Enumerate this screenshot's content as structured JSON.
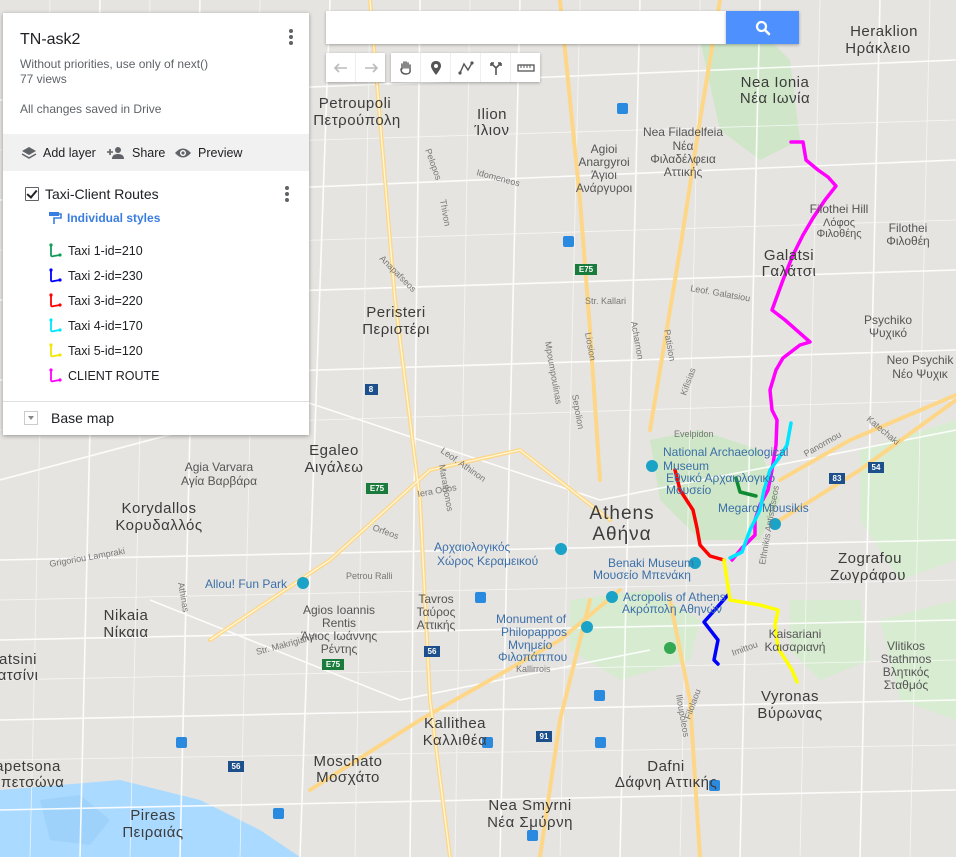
{
  "panel": {
    "title": "TN-ask2",
    "description": "Without priorities, use only of next()",
    "views": "77 views",
    "saved": "All changes saved in Drive",
    "actions": {
      "add_layer": "Add layer",
      "share": "Share",
      "preview": "Preview"
    },
    "layer": {
      "name": "Taxi-Client Routes",
      "styles": "Individual styles",
      "routes": [
        {
          "label": "Taxi 1-id=210",
          "color": "#0f9d58"
        },
        {
          "label": "Taxi 2-id=230",
          "color": "#0000ff"
        },
        {
          "label": "Taxi 3-id=220",
          "color": "#ff0000"
        },
        {
          "label": "Taxi 4-id=170",
          "color": "#00ffff"
        },
        {
          "label": "Taxi 5-id=120",
          "color": "#ffff00"
        },
        {
          "label": "CLIENT ROUTE",
          "color": "#ff00ff"
        }
      ]
    },
    "basemap": "Base map"
  },
  "search": {
    "placeholder": "",
    "value": ""
  },
  "toolbar_icons": [
    "undo-icon",
    "redo-icon",
    "hand-icon",
    "marker-icon",
    "draw-line-icon",
    "directions-icon",
    "ruler-icon"
  ],
  "map": {
    "places": [
      {
        "id": "heraklion",
        "l1": "Heraklion",
        "l2": "Ηράκλειο"
      },
      {
        "id": "neaionia",
        "l1": "Nea Ionia",
        "l2": "Νέα Ιωνία"
      },
      {
        "id": "petroupoli",
        "l1": "Petroupoli",
        "l2": "Πετρούπολη"
      },
      {
        "id": "ilion",
        "l1": "Ilion",
        "l2": "Ίλιον"
      },
      {
        "id": "agioianargyroi",
        "l1": "Agioi",
        "l2": "Anargyroi",
        "l3": "Άγιοι",
        "l4": "Ανάργυροι"
      },
      {
        "id": "neafiladelfeia",
        "l1": "Nea Filadelfeia",
        "l2": "Νέα",
        "l3": "Φιλαδέλφεια",
        "l4": "Αττικής"
      },
      {
        "id": "filothei",
        "l1": "Filothei Hill",
        "l2": "Λόφος",
        "l3": "Φιλοθέης"
      },
      {
        "id": "filothei2",
        "l1": "Filothei",
        "l2": "Φιλοθέη"
      },
      {
        "id": "galatsi",
        "l1": "Galatsi",
        "l2": "Γαλάτσι"
      },
      {
        "id": "peristeri",
        "l1": "Peristeri",
        "l2": "Περιστέρι"
      },
      {
        "id": "psychiko",
        "l1": "Psychiko",
        "l2": "Ψυχικό"
      },
      {
        "id": "neopsychiko",
        "l1": "Neo Psychik",
        "l2": "Νέο Ψυχικ"
      },
      {
        "id": "egaleo",
        "l1": "Egaleo",
        "l2": "Αιγάλεω"
      },
      {
        "id": "agiavarvara",
        "l1": "Agia Varvara",
        "l2": "Αγία Βαρβάρα"
      },
      {
        "id": "korydallos",
        "l1": "Korydallos",
        "l2": "Κορυδαλλός"
      },
      {
        "id": "athens",
        "l1": "Athens",
        "l2": "Αθήνα"
      },
      {
        "id": "zografou",
        "l1": "Zografou",
        "l2": "Ζωγράφου"
      },
      {
        "id": "nikaia",
        "l1": "Nikaia",
        "l2": "Νίκαια"
      },
      {
        "id": "atsini",
        "l1": "atsini",
        "l2": "ατσίνι"
      },
      {
        "id": "agiosioannis",
        "l1": "Agios Ioannis",
        "l2": "Rentis",
        "l3": "Άγιος Ιωάννης",
        "l4": "Ρέντης"
      },
      {
        "id": "tavros",
        "l1": "Tavros",
        "l2": "Ταύρος",
        "l3": "Αττικής"
      },
      {
        "id": "kaisariani",
        "l1": "Kaisariani",
        "l2": "Καισαριανή"
      },
      {
        "id": "vlitikos",
        "l1": "Vlitikos",
        "l2": "Stathmos",
        "l3": "Βλητικός",
        "l4": "Σταθμός"
      },
      {
        "id": "vyronas",
        "l1": "Vyronas",
        "l2": "Βύρωνας"
      },
      {
        "id": "kallithea",
        "l1": "Kallithea",
        "l2": "Καλλιθέα"
      },
      {
        "id": "moschato",
        "l1": "Moschato",
        "l2": "Μοσχάτο"
      },
      {
        "id": "dafni",
        "l1": "Dafni",
        "l2": "Δάφνη Αττικής"
      },
      {
        "id": "apetsona",
        "l1": "apetsona",
        "l2": "απετσώνα"
      },
      {
        "id": "pireas",
        "l1": "Pireas",
        "l2": "Πειραιάς"
      },
      {
        "id": "neasmyrni",
        "l1": "Nea Smyrni",
        "l2": "Νέα Σμύρνη"
      }
    ],
    "pois": [
      {
        "id": "archmuseum",
        "l1": "National Archaeological",
        "l2": "Museum",
        "l3": "Εθνικό Αρχαιολογικό",
        "l4": "Μουσείο"
      },
      {
        "id": "megaro",
        "l1": "Megaro Mousikis"
      },
      {
        "id": "keramikos",
        "l1": "Αρχαιολογικός",
        "l2": "Χώρος Κεραμεικού"
      },
      {
        "id": "benaki",
        "l1": "Benaki Museum",
        "l2": "Μουσείο Μπενάκη"
      },
      {
        "id": "acropolis",
        "l1": "Acropolis of Athens",
        "l2": "Ακρόπολη Αθηνών"
      },
      {
        "id": "philopappos",
        "l1": "Monument of",
        "l2": "Philopappos",
        "l3": "Μνημείο",
        "l4": "Φιλοπάππου"
      },
      {
        "id": "allou",
        "l1": "Allou! Fun Park"
      }
    ],
    "streets": [
      "Leof. Athinon",
      "Iera Odos",
      "Petrou Ralli",
      "Kallirrois",
      "Ilioupoleos",
      "Katechaki",
      "Leof. Galatsiou",
      "Patision",
      "Acharnon",
      "Liosion",
      "Sepolion",
      "Kifisias",
      "Evelpidon",
      "Panormou",
      "Mpoumpoulinas",
      "Str. Kallari",
      "Thivon",
      "Idomeneos",
      "Anapafseos",
      "Pelopos",
      "Imittou",
      "Ethnikis Antistaseos",
      "Filolaou",
      "Orfeos",
      "Marathonos",
      "Str. Makrigianni",
      "Athinas",
      "Grigoriou Lampraki"
    ],
    "shields": [
      "E75",
      "8",
      "E75",
      "E75",
      "83",
      "54",
      "56",
      "91",
      "56",
      "E75"
    ]
  }
}
